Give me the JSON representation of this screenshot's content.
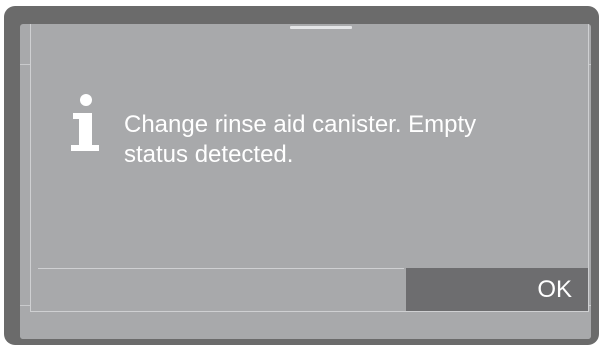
{
  "dialog": {
    "icon": "info-icon",
    "message": "Change rinse aid canister. Empty status detected.",
    "ok_label": "OK"
  },
  "colors": {
    "bezel": "#6b6b6b",
    "screen": "#a8a9ab",
    "button": "#6d6d6f",
    "text": "#ffffff"
  }
}
